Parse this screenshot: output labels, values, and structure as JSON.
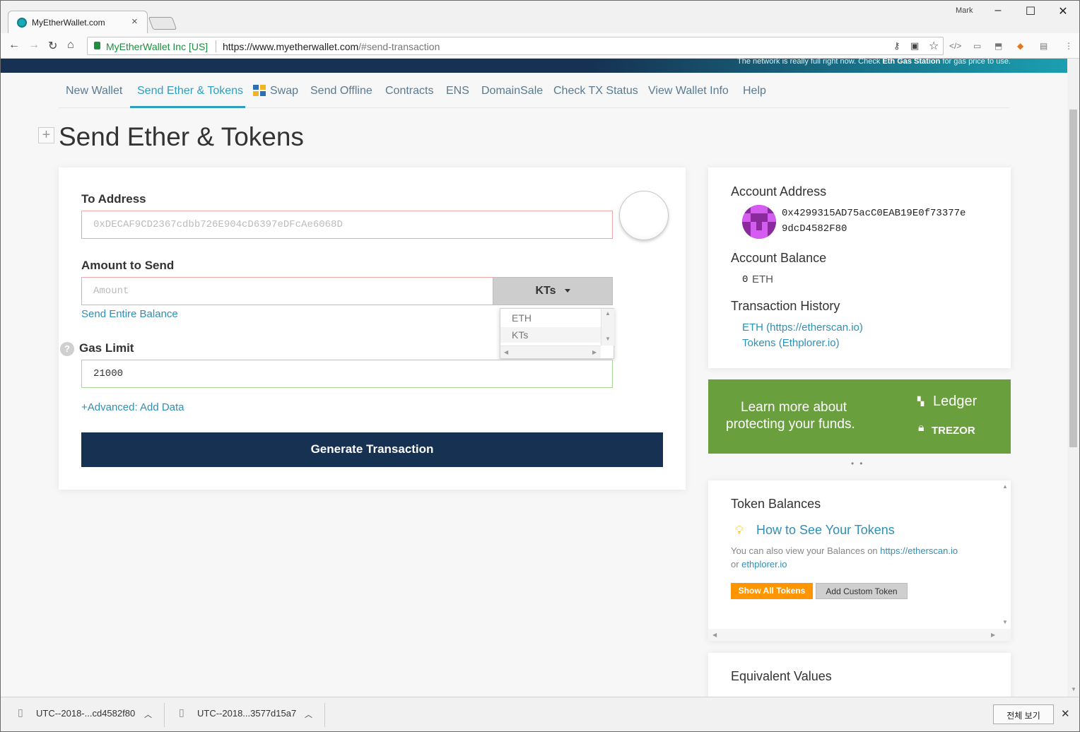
{
  "browser": {
    "tab_title": "MyEtherWallet.com",
    "user": "Mark",
    "org_label": "MyEtherWallet Inc [US]",
    "url_host": "https://www.myetherwallet.com",
    "url_path": "/#send-transaction"
  },
  "banner": {
    "text_pre": "The network is really full right now. Check ",
    "text_bold": "Eth Gas Station",
    "text_post": " for gas price to use."
  },
  "nav": {
    "items": [
      "New Wallet",
      "Send Ether & Tokens",
      "Swap",
      "Send Offline",
      "Contracts",
      "ENS",
      "DomainSale",
      "Check TX Status",
      "View Wallet Info",
      "Help"
    ],
    "active": "Send Ether & Tokens"
  },
  "page": {
    "title": "Send Ether & Tokens"
  },
  "form": {
    "to_label": "To Address",
    "to_placeholder": "0xDECAF9CD2367cdbb726E904cD6397eDFcAe6068D",
    "amount_label": "Amount to Send",
    "amount_placeholder": "Amount",
    "token_selected": "KTs",
    "token_options": [
      "ETH",
      "KTs"
    ],
    "send_entire": "Send Entire Balance",
    "gas_label": "Gas Limit",
    "gas_value": "21000",
    "advanced": "+Advanced: Add Data",
    "generate": "Generate Transaction"
  },
  "account": {
    "address_label": "Account Address",
    "address_line1": "0x4299315AD75acC0EAB19E0f73377e",
    "address_line2": "9dcD4582F80",
    "balance_label": "Account Balance",
    "balance_value": "0",
    "balance_unit": "ETH",
    "history_label": "Transaction History",
    "history_eth": "ETH (https://etherscan.io)",
    "history_tokens": "Tokens (Ethplorer.io)"
  },
  "promo": {
    "line1": "Learn more about",
    "line2": "protecting your funds.",
    "ledger": "Ledger",
    "trezor": "TREZOR"
  },
  "tokens": {
    "title": "Token Balances",
    "howto": "How to See Your Tokens",
    "info_pre": "You can also view your Balances on ",
    "info_link1": "https://etherscan.io",
    "info_or": "or ",
    "info_link2": "ethplorer.io",
    "show_all": "Show All Tokens",
    "add_custom": "Add Custom Token"
  },
  "equivalent": {
    "title": "Equivalent Values"
  },
  "downloads": {
    "file1": "UTC--2018-...cd4582f80",
    "file2": "UTC--2018...3577d15a7",
    "show_all": "전체 보기"
  },
  "colors": {
    "accent": "#2f9ec0",
    "navy": "#163151",
    "ledger_green": "#6a9f3e",
    "orange": "#ff9500"
  }
}
